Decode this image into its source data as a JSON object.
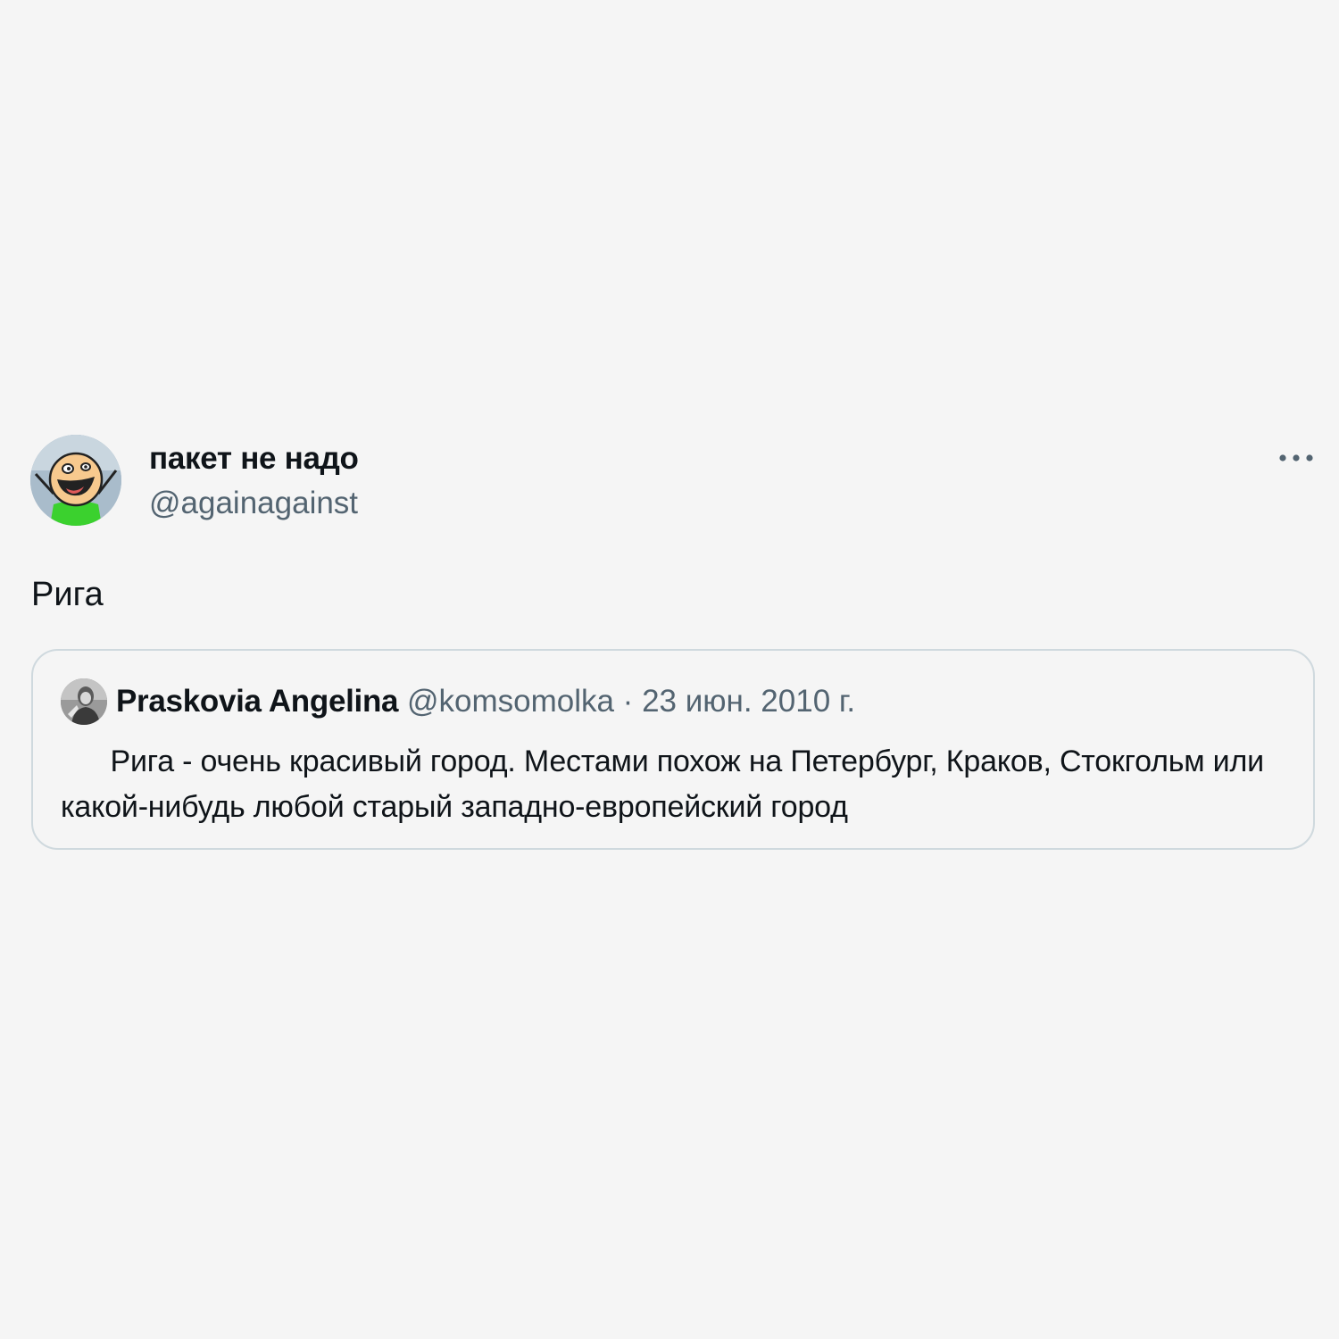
{
  "tweet": {
    "author": {
      "display_name": "пакет не надо",
      "handle": "@againagainst",
      "avatar_icon": "cartoon-face-avatar"
    },
    "more_icon": "more-options-icon",
    "text": "Рига"
  },
  "quoted_tweet": {
    "author": {
      "display_name": "Praskovia Angelina",
      "handle": "@komsomolka",
      "avatar_icon": "person-photo-avatar"
    },
    "separator": "·",
    "date": "23 июн. 2010 г.",
    "text": "      Рига - очень красивый город. Местами похож на Петербург, Краков, Стокгольм или какой-нибудь любой старый западно-европейский город"
  },
  "colors": {
    "background": "#f5f5f5",
    "primary_text": "#0f1419",
    "secondary_text": "#536471",
    "border": "#cfd9de"
  }
}
